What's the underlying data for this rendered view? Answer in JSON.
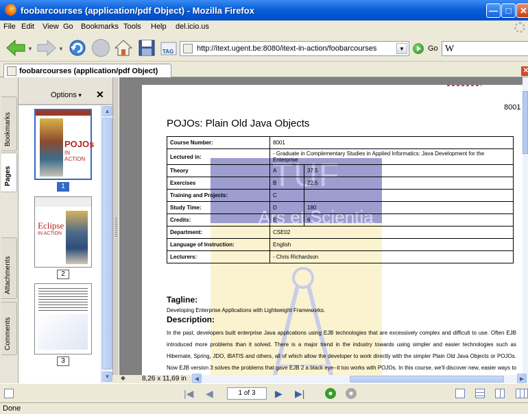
{
  "window": {
    "title": "foobarcourses (application/pdf Object) - Mozilla Firefox",
    "min_glyph": "—",
    "max_glyph": "□",
    "close_glyph": "✕"
  },
  "menu": [
    "File",
    "Edit",
    "View",
    "Go",
    "Bookmarks",
    "Tools",
    "Help",
    "del.icio.us"
  ],
  "nav": {
    "url": "http://itext.ugent.be:8080/itext-in-action/foobarcourses",
    "go_label": "Go",
    "search_value": "W",
    "tag_label": "TAG"
  },
  "tab": {
    "label": "foobarcourses (application/pdf Object)",
    "close": "✕"
  },
  "sidebar": {
    "tabs": [
      "Bookmarks",
      "Pages",
      "Attachments",
      "Comments"
    ],
    "active_tab": "Pages",
    "options_label": "Options",
    "close_label": "✕",
    "thumbnails": [
      {
        "number": "1",
        "selected": true,
        "title": "POJOs",
        "subtitle": "IN ACTION"
      },
      {
        "number": "2",
        "selected": false,
        "title": "Eclipse",
        "subtitle": "IN ACTION"
      },
      {
        "number": "3",
        "selected": false
      }
    ]
  },
  "document": {
    "page_number": "8001",
    "title": "POJOs: Plain Old Java Objects",
    "watermark_main": "TUF",
    "watermark_sub": "Ars et Scientia",
    "table": [
      {
        "key": "Course Number:",
        "letter": "",
        "value": "8001",
        "span": true
      },
      {
        "key": "Lectured in:",
        "letter": "",
        "value": "- Graduate in Complementary Studies in Applied Informatics: Java Development for the Enterprise",
        "span": true
      },
      {
        "key": "Theory",
        "letter": "A",
        "value": "37.5",
        "span": false
      },
      {
        "key": "Exercises",
        "letter": "B",
        "value": "22.5",
        "span": false
      },
      {
        "key": "Training and Projects:",
        "letter": "C",
        "value": "",
        "span": false
      },
      {
        "key": "Study Time:",
        "letter": "D",
        "value": "180",
        "span": false
      },
      {
        "key": "Credits:",
        "letter": "E",
        "value": "6",
        "span": false
      },
      {
        "key": "Department:",
        "letter": "",
        "value": "CSE02",
        "span": true
      },
      {
        "key": "Language of Instruction:",
        "letter": "",
        "value": "English",
        "span": true
      },
      {
        "key": "Lecturers:",
        "letter": "",
        "value": "- Chris Richardson",
        "span": true
      }
    ],
    "tagline_heading": "Tagline:",
    "tagline_text": "Developing Enterprise Applications with Lightweight Frameworks.",
    "description_heading": "Description:",
    "description_text": "In the past, developers built enterprise Java applications using EJB technologies that are excessively complex and difficult to use. Often EJB introduced more problems than it solved. There is a major trend in the industry towards using simpler and easier technologies such as Hibernate, Spring, JDO, iBATIS and others, all of which allow the developer to work directly with the simpler Plain Old Java Objects or POJOs. Now EJB version 3 solves the problems that gave EJB 2 a black eye--it too works with POJOs. In this course, we'll discover new, easier ways to develop enterprise Java applications and how to make key design decisions when"
  },
  "viewer": {
    "page_size": "8,26 x 11,69 in",
    "page_indicator": "1 of 3"
  },
  "status": {
    "text": "Done"
  }
}
